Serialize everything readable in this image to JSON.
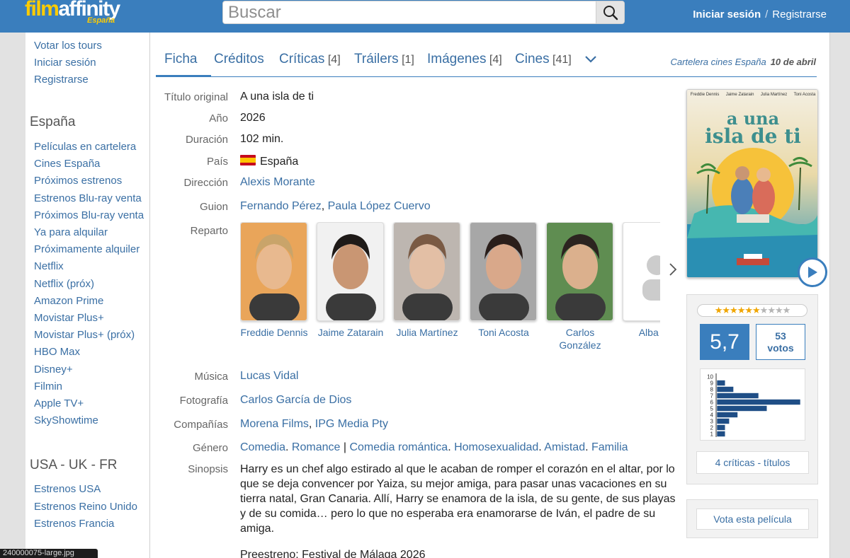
{
  "header": {
    "logo_text_main": "film",
    "logo_text_accent": "affinity",
    "logo_sub": "España",
    "search_placeholder": "Buscar",
    "login": "Iniciar sesión",
    "separator": "/",
    "register": "Registrarse"
  },
  "sidebar": {
    "top_links": [
      "Votar los tours",
      "Iniciar sesión",
      "Registrarse"
    ],
    "section_es_title": "España",
    "section_es_links": [
      "Películas en cartelera",
      "Cines España",
      "Próximos estrenos",
      "Estrenos Blu-ray venta",
      "Próximos Blu-ray venta",
      "Ya para alquilar",
      "Próximamente alquiler",
      "Netflix",
      "Netflix (próx)",
      "Amazon Prime",
      "Movistar Plus+",
      "Movistar Plus+ (próx)",
      "HBO Max",
      "Disney+",
      "Filmin",
      "Apple TV+",
      "SkyShowtime"
    ],
    "section_int_title": "USA - UK - FR",
    "section_int_links": [
      "Estrenos USA",
      "Estrenos Reino Unido",
      "Estrenos Francia"
    ]
  },
  "tabs": [
    {
      "label": "Ficha",
      "count": ""
    },
    {
      "label": "Créditos",
      "count": ""
    },
    {
      "label": "Críticas",
      "count": "[4]"
    },
    {
      "label": "Tráilers",
      "count": "[1]"
    },
    {
      "label": "Imágenes",
      "count": "[4]"
    },
    {
      "label": "Cines",
      "count": "[41]"
    }
  ],
  "cartelera": {
    "text": "Cartelera cines España",
    "date": "10 de abril"
  },
  "movie": {
    "labels": {
      "original_title": "Título original",
      "year": "Año",
      "duration": "Duración",
      "country": "País",
      "direction": "Dirección",
      "script": "Guion",
      "cast": "Reparto",
      "music": "Música",
      "photography": "Fotografía",
      "companies": "Compañías",
      "genre": "Género",
      "synopsis": "Sinopsis"
    },
    "original_title": "A una isla de ti",
    "year": "2026",
    "duration": "102 min.",
    "country": "España",
    "director": "Alexis Morante",
    "script": [
      "Fernando Pérez",
      "Paula López Cuervo"
    ],
    "cast": [
      {
        "name": "Freddie Dennis",
        "skin": "#e8b98f",
        "hair": "#c9a46a",
        "bg": "#e9a55a"
      },
      {
        "name": "Jaime Zatarain",
        "skin": "#c99673",
        "hair": "#1e1a18",
        "bg": "#f1f1f1"
      },
      {
        "name": "Julia Martínez",
        "skin": "#e3bfa5",
        "hair": "#7a5a44",
        "bg": "#bdb6b0"
      },
      {
        "name": "Toni Acosta",
        "skin": "#d9a88a",
        "hair": "#2a1e1a",
        "bg": "#a7a7a7"
      },
      {
        "name": "Carlos González",
        "skin": "#dbb08d",
        "hair": "#2c2420",
        "bg": "#5f8d51"
      },
      {
        "name": "Alba Gu",
        "skin": "",
        "hair": "",
        "bg": "#ffffff"
      }
    ],
    "music": "Lucas Vidal",
    "photography": "Carlos García de Dios",
    "companies": [
      "Morena Films",
      "IPG Media Pty"
    ],
    "genre": {
      "main": [
        "Comedia",
        "Romance"
      ],
      "sep": "|",
      "tags": [
        "Comedia romántica",
        "Homosexualidad",
        "Amistad",
        "Familia"
      ]
    },
    "synopsis": "Harry es un chef algo estirado al que le acaban de romper el corazón en el altar, por lo que se deja convencer por Yaiza, su mejor amiga, para pasar unas vacaciones en su tierra natal, Gran Canaria. Allí, Harry se enamora de la isla, de su gente, de sus playas y de su comida… pero lo que no esperaba era enamorarse de Iván, el padre de su amiga.",
    "preestreno": "Preestreno: Festival de Málaga 2026"
  },
  "poster": {
    "credits": [
      "Freddie Dennis",
      "Jaime Zatarain",
      "Julia Martínez",
      "Toni Acosta"
    ],
    "title_line1": "a una",
    "title_line2": "isla de ti"
  },
  "rating": {
    "stars_on": 6,
    "stars_total": 10,
    "average": "5,7",
    "votes_count": "53",
    "votes_label": "votos",
    "histogram_labels": [
      "10",
      "9",
      "8",
      "7",
      "6",
      "5",
      "4",
      "3",
      "2",
      "1"
    ],
    "histogram_values": [
      0,
      2,
      4,
      10,
      20,
      12,
      5,
      3,
      2,
      2
    ],
    "critics_button": "4 críticas - títulos",
    "vote_button": "Vota esta película"
  },
  "colors": {
    "header": "#3a7ebd",
    "link": "#3a6fa4",
    "star": "#f0a500"
  },
  "file_tag": "240000075-large.jpg"
}
